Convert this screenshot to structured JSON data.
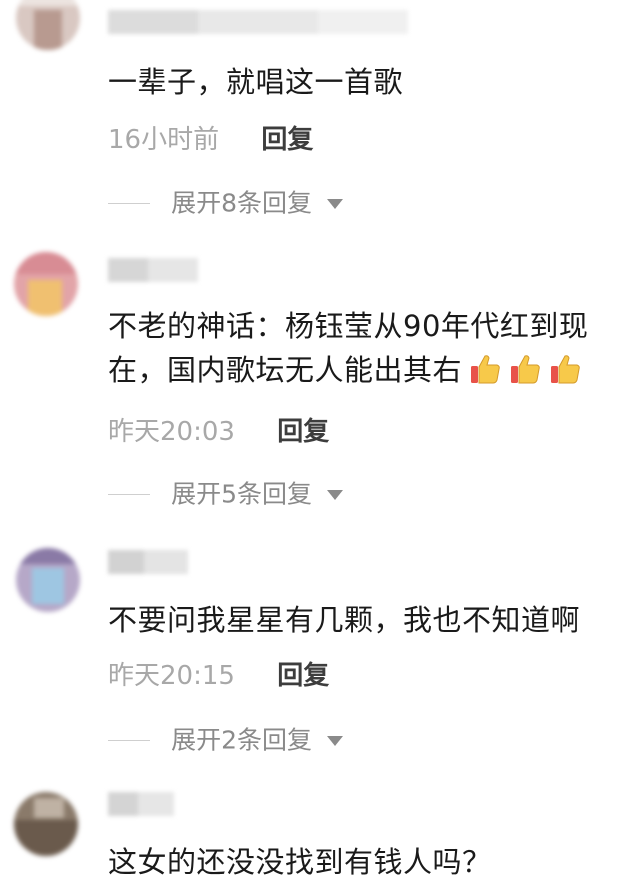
{
  "comments": [
    {
      "text_line1": "一辈子，就唱这一首歌",
      "time": "16小时前",
      "reply_label": "回复",
      "expand_label": "展开8条回复"
    },
    {
      "text_line1": "不老的神话：杨钰莹从90年代红到现",
      "text_line2": "在，国内歌坛无人能出其右",
      "emoji": "thumbs-up-icon ×3",
      "time": "昨天20:03",
      "reply_label": "回复",
      "expand_label": "展开5条回复"
    },
    {
      "text_line1": "不要问我星星有几颗，我也不知道啊",
      "time": "昨天20:15",
      "reply_label": "回复",
      "expand_label": "展开2条回复"
    },
    {
      "text_line1": "这女的还没没找到有钱人吗？"
    }
  ],
  "colors": {
    "text": "#1a1a1a",
    "time": "#a8a8a8",
    "reply": "#3d3d3d",
    "expand": "#8a8a8a"
  }
}
